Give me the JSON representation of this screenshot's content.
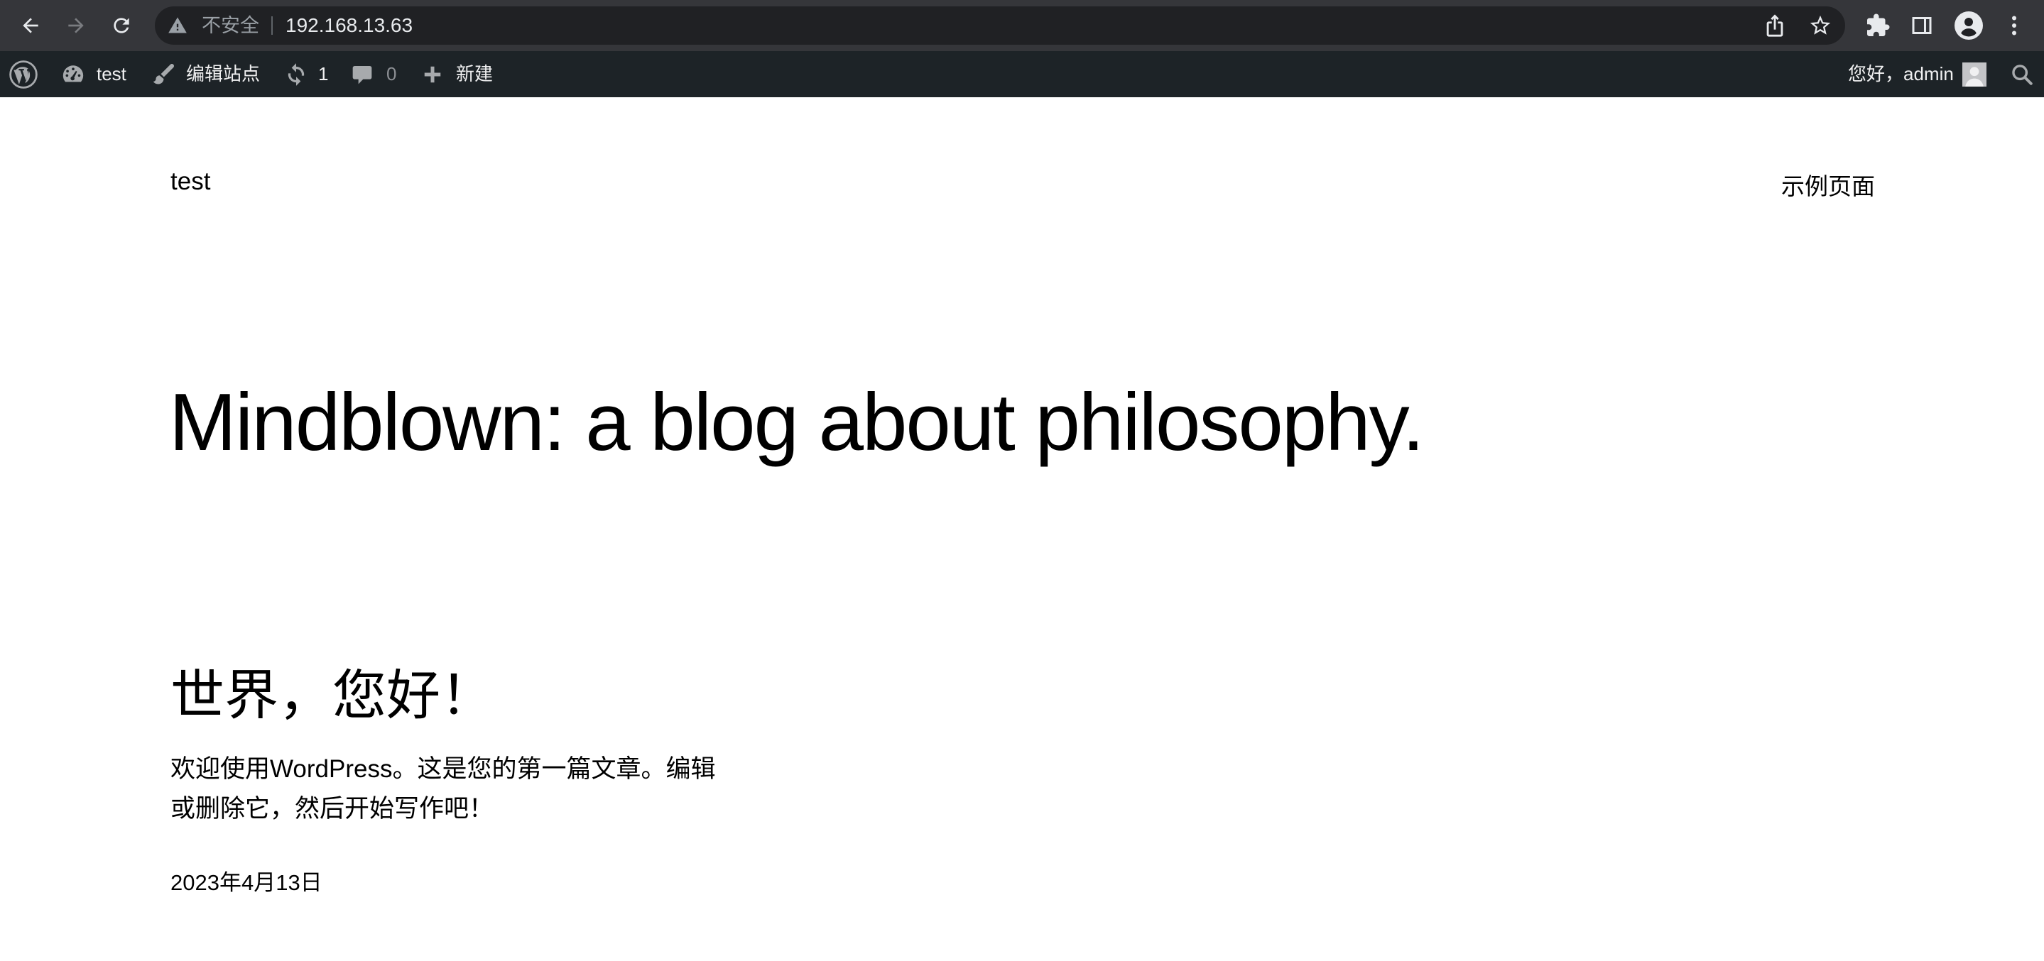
{
  "browser": {
    "security_label": "不安全",
    "url": "192.168.13.63",
    "icons": [
      "back-icon",
      "forward-icon",
      "reload-icon",
      "warning-icon",
      "share-icon",
      "bookmark-star-icon",
      "extensions-icon",
      "side-panel-icon",
      "profile-icon",
      "menu-kebab-icon"
    ]
  },
  "adminbar": {
    "site_name": "test",
    "customize_label": "编辑站点",
    "updates_count": "1",
    "comments_count": "0",
    "new_label": "新建",
    "greeting": "您好，admin",
    "colors": {
      "background": "#1d2327",
      "text": "#f0f0f1"
    }
  },
  "site": {
    "title": "test",
    "nav": [
      {
        "label": "示例页面"
      }
    ],
    "tagline": "Mindblown: a blog about philosophy."
  },
  "post": {
    "title": "世界，您好！",
    "excerpt_line1": "欢迎使用WordPress。这是您的第一篇文章。编辑",
    "excerpt_line2": "或删除它，然后开始写作吧！",
    "date": "2023年4月13日"
  }
}
